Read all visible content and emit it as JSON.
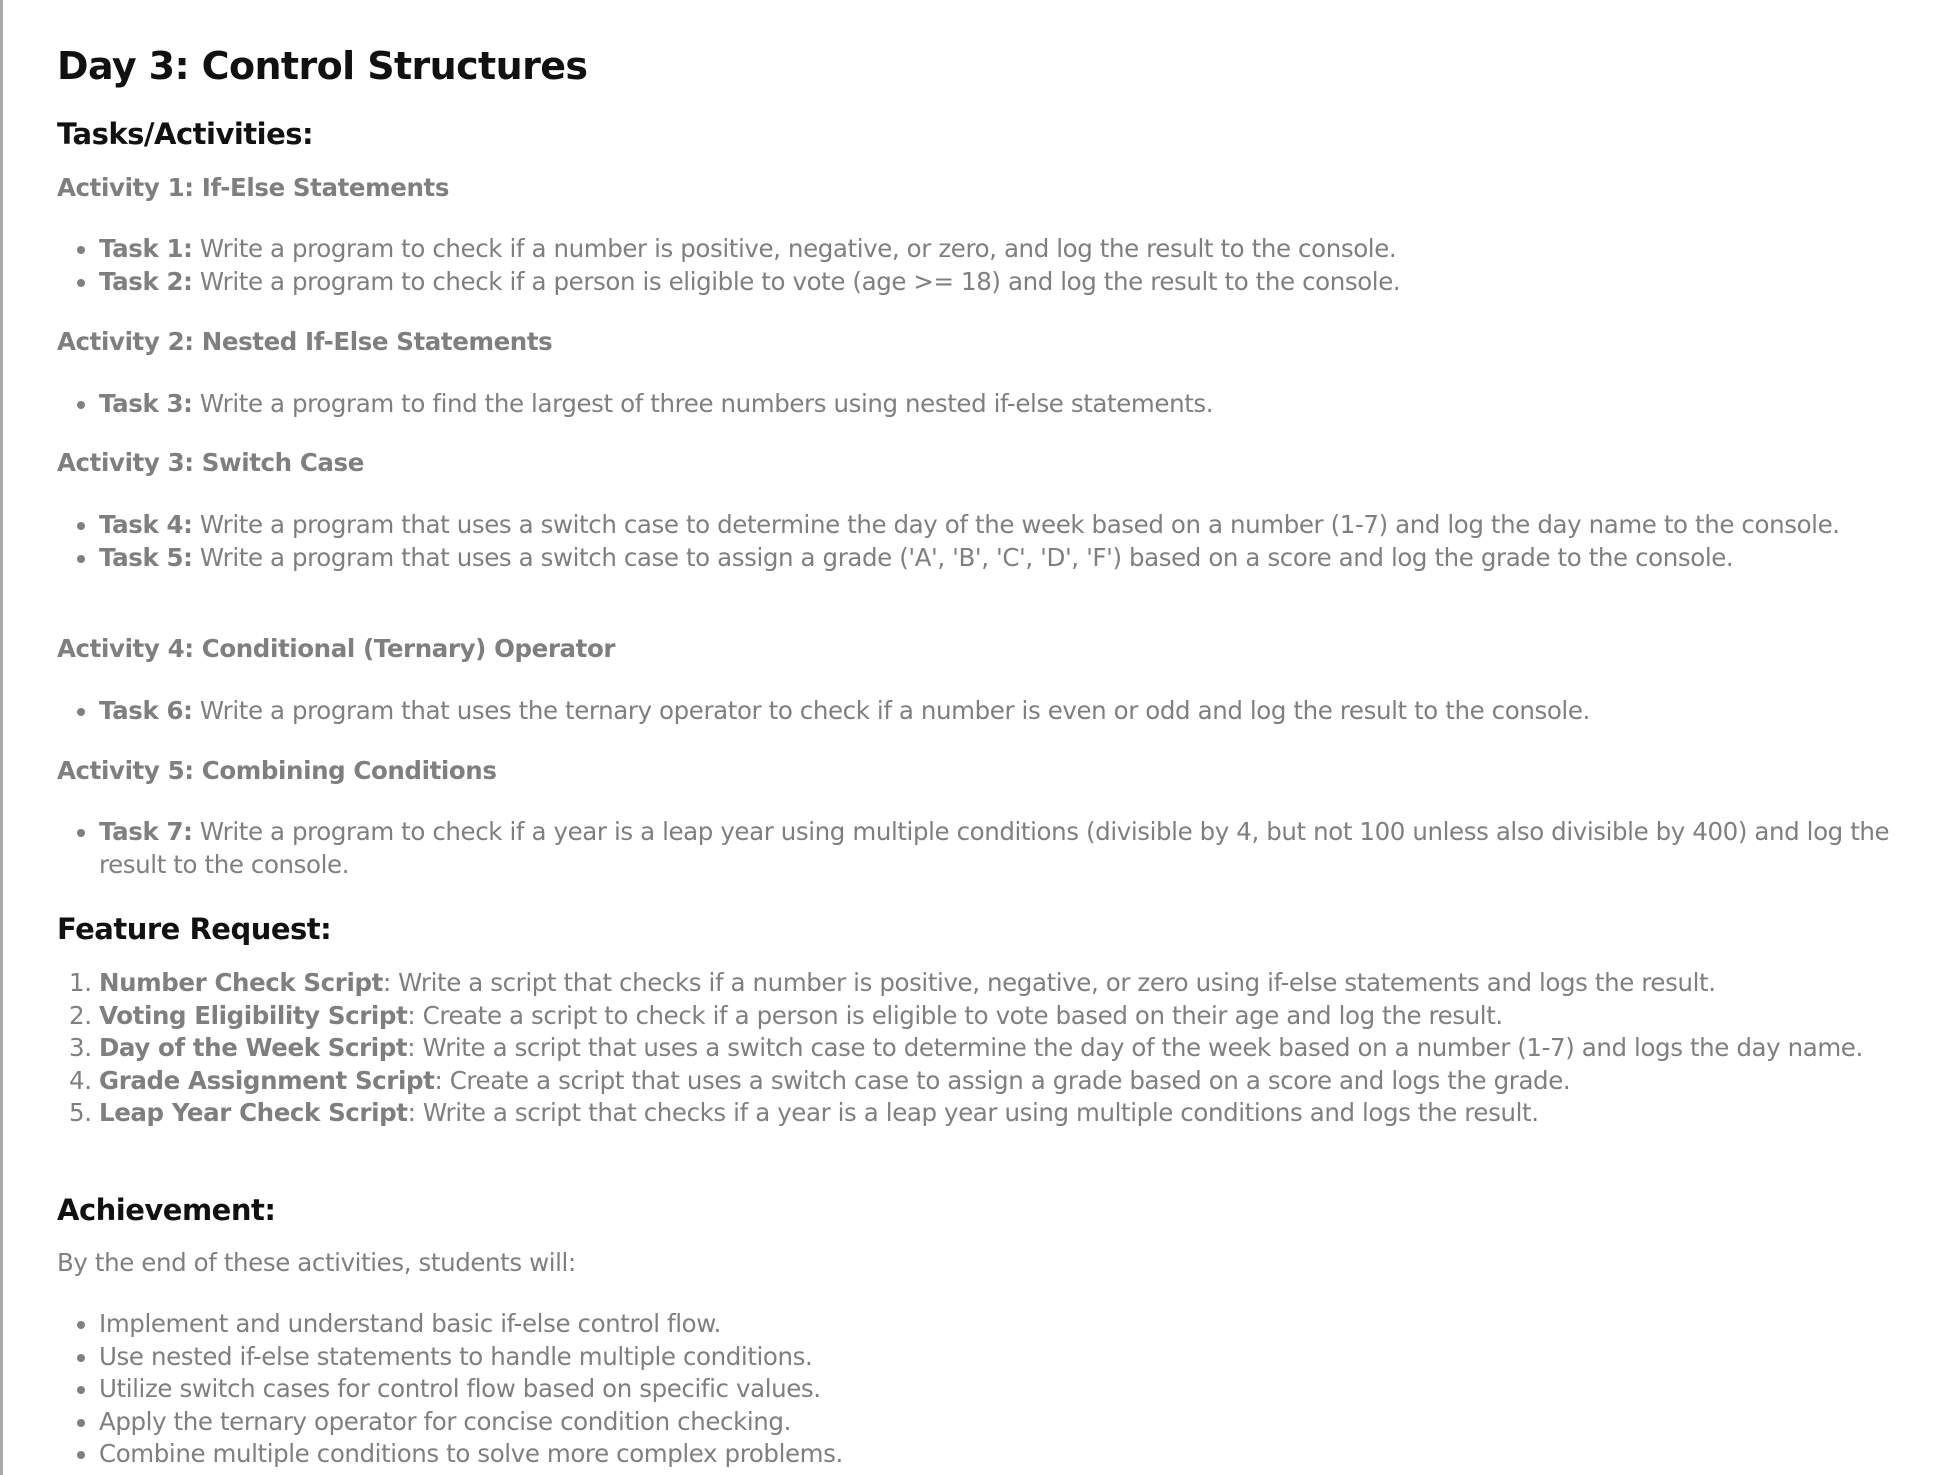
{
  "title": "Day 3: Control Structures",
  "tasks_heading": "Tasks/Activities:",
  "activities": [
    {
      "title": "Activity 1: If-Else Statements",
      "tasks": [
        {
          "label": "Task 1:",
          "text": " Write a program to check if a number is positive, negative, or zero, and log the result to the console."
        },
        {
          "label": "Task 2:",
          "text": " Write a program to check if a person is eligible to vote (age >= 18) and log the result to the console."
        }
      ]
    },
    {
      "title": "Activity 2: Nested If-Else Statements",
      "tasks": [
        {
          "label": "Task 3:",
          "text": " Write a program to find the largest of three numbers using nested if-else statements."
        }
      ]
    },
    {
      "title": "Activity 3: Switch Case",
      "tasks": [
        {
          "label": "Task 4:",
          "text": " Write a program that uses a switch case to determine the day of the week based on a number (1-7) and log the day name to the console."
        },
        {
          "label": "Task 5:",
          "text": " Write a program that uses a switch case to assign a grade ('A', 'B', 'C', 'D', 'F') based on a score and log the grade to the console."
        }
      ]
    },
    {
      "title": "Activity 4: Conditional (Ternary) Operator",
      "tasks": [
        {
          "label": "Task 6:",
          "text": " Write a program that uses the ternary operator to check if a number is even or odd and log the result to the console."
        }
      ]
    },
    {
      "title": "Activity 5: Combining Conditions",
      "tasks": [
        {
          "label": "Task 7:",
          "text": " Write a program to check if a year is a leap year using multiple conditions (divisible by 4, but not 100 unless also divisible by 400) and log the result to the console."
        }
      ]
    }
  ],
  "feature_heading": "Feature Request:",
  "features": [
    {
      "label": "Number Check Script",
      "text": ": Write a script that checks if a number is positive, negative, or zero using if-else statements and logs the result."
    },
    {
      "label": "Voting Eligibility Script",
      "text": ": Create a script to check if a person is eligible to vote based on their age and log the result."
    },
    {
      "label": "Day of the Week Script",
      "text": ": Write a script that uses a switch case to determine the day of the week based on a number (1-7) and logs the day name."
    },
    {
      "label": "Grade Assignment Script",
      "text": ": Create a script that uses a switch case to assign a grade based on a score and logs the grade."
    },
    {
      "label": "Leap Year Check Script",
      "text": ": Write a script that checks if a year is a leap year using multiple conditions and logs the result."
    }
  ],
  "achievement_heading": "Achievement:",
  "achievement_intro": "By the end of these activities, students will:",
  "achievements": [
    "Implement and understand basic if-else control flow.",
    "Use nested if-else statements to handle multiple conditions.",
    "Utilize switch cases for control flow based on specific values.",
    "Apply the ternary operator for concise condition checking.",
    "Combine multiple conditions to solve more complex problems."
  ]
}
